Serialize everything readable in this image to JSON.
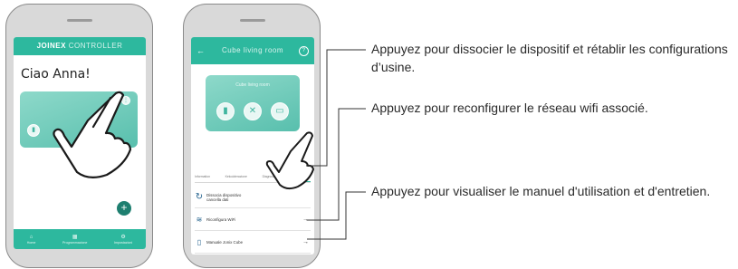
{
  "phone1": {
    "header_title_part1": "JOINEX",
    "header_title_part2": "CONTROLLER",
    "greeting": "Ciao Anna!",
    "nav": [
      {
        "label": "Home",
        "icon": "home-icon"
      },
      {
        "label": "Programmazione",
        "icon": "calendar-icon"
      },
      {
        "label": "Impostazioni",
        "icon": "gear-icon"
      }
    ],
    "fab_label": "+"
  },
  "phone2": {
    "header_title": "Cube living room",
    "card_title": "Cube living room",
    "tabs": [
      "Information",
      "Keko/alerazione",
      "Diagnosing",
      "Connessione"
    ],
    "rows": [
      {
        "label": "Dissocia dispositivo cancella dati",
        "icon": "reset-icon"
      },
      {
        "label": "Riconfigura WiFi",
        "icon": "wifi-icon"
      },
      {
        "label": "Manuale Jonix Cube",
        "icon": "book-icon"
      }
    ],
    "arrow": "→"
  },
  "annotations": [
    {
      "text": "Appuyez pour dissocier le dispositif et rétablir les configurations d’usine."
    },
    {
      "text": "Appuyez pour reconfigurer le réseau wifi associé."
    },
    {
      "text": "Appuyez pour visualiser le manuel d'utilisation et d'entretien."
    }
  ],
  "colors": {
    "accent": "#2db89e",
    "card": "#7ccfbf",
    "phone_frame": "#d9d9d9",
    "hand_outline": "#1a1a1a"
  }
}
